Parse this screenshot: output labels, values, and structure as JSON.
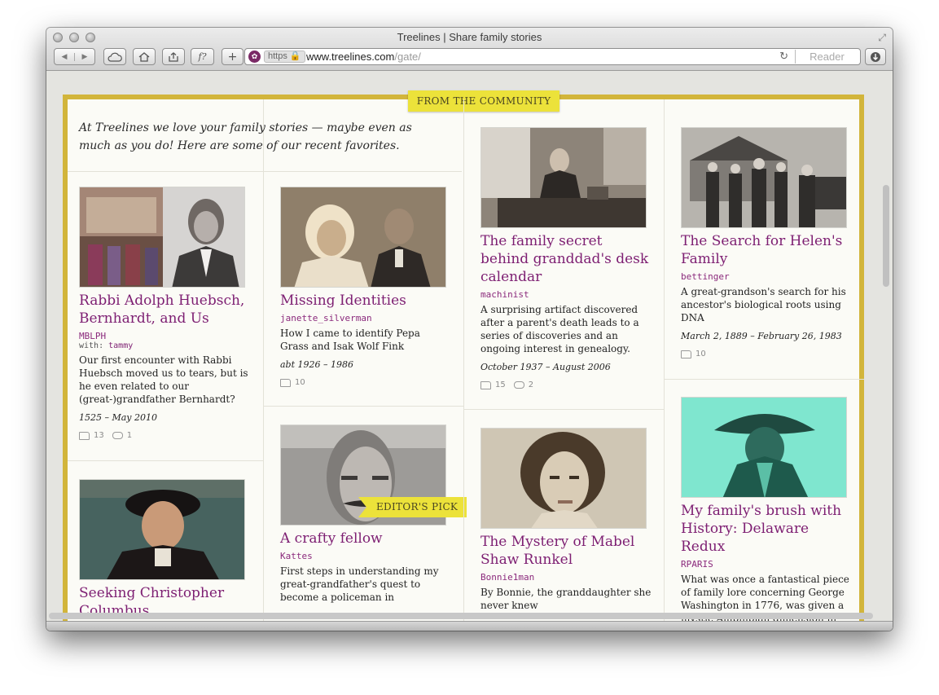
{
  "window": {
    "title": "Treelines | Share family stories"
  },
  "toolbar": {
    "back_icon": "back-arrow-icon",
    "forward_icon": "forward-arrow-icon",
    "icloud_icon": "cloud-icon",
    "home_icon": "home-icon",
    "share_icon": "share-icon",
    "fb_label": "f?",
    "add_label": "+",
    "download_icon": "download-icon"
  },
  "address_bar": {
    "https_label": "https",
    "domain": "www.treelines.com",
    "path": "/gate/",
    "reader_label": "Reader"
  },
  "page": {
    "ribbon_community": "FROM THE COMMUNITY",
    "ribbon_editor": "EDITOR'S PICK",
    "intro": "At Treelines we love your family stories — maybe even as much as you do! Here are some of our recent favorites."
  },
  "stories": [
    {
      "title": "Rabbi Adolph Huebsch, Bernhardt, and Us",
      "author": "MBLPH",
      "with_label": "with:",
      "with_user": "tammy",
      "desc": "Our first encounter with Rabbi Huebsch moved us to tears, but is he even related to our (great-)grandfather Bernhardt?",
      "dates": "1525 – May 2010",
      "stories": "13",
      "comments": "1"
    },
    {
      "title": "Seeking Christopher Columbus",
      "author": "",
      "desc": "",
      "dates": ""
    },
    {
      "title": "Missing Identities",
      "author": "janette_silverman",
      "desc": "How I came to identify Pepa Grass and Isak Wolf Fink",
      "dates": "abt 1926 – 1986",
      "stories": "10"
    },
    {
      "title": "A crafty fellow",
      "author": "Kattes",
      "desc": "First steps in understanding my great-grandfather's quest to become a policeman in"
    },
    {
      "title": "The family secret behind granddad's desk calendar",
      "author": "machinist",
      "desc": "A surprising artifact discovered after a parent's death leads to a series of discoveries and an ongoing interest in genealogy.",
      "dates": "October 1937 – August 2006",
      "stories": "15",
      "comments": "2"
    },
    {
      "title": "The Mystery of Mabel Shaw Runkel",
      "author": "Bonnie1man",
      "desc": "By Bonnie, the granddaughter she never knew"
    },
    {
      "title": "The Search for Helen's Family",
      "author": "bettinger",
      "desc": "A great-grandson's search for his ancestor's biological roots using DNA",
      "dates": "March 2, 1889 – February 26, 1983",
      "stories": "10"
    },
    {
      "title": "My family's brush with History: Delaware Redux",
      "author": "RPARIS",
      "desc": "What was once a fantastical piece of family lore concerning George Washington in 1776, was given a mystic Amphibian dimension in"
    }
  ]
}
